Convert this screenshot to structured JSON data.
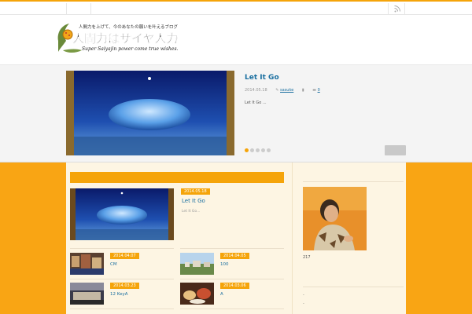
{
  "topbar": {
    "home_label": " ",
    "rss_icon": "rss-icon"
  },
  "header": {
    "logo_tagline": "人間力を上げて、今のあなたの願いを叶えるブログ",
    "logo_title": "人間力はサイヤ人力",
    "logo_subtitle": "Super Saiyajin power come true wishes."
  },
  "slider": {
    "title": "Let It Go",
    "date": "2014.05.18",
    "author": "sasuke",
    "comments": "0",
    "excerpt": "Let It Go ...",
    "slide_count": 5,
    "active_index": 0
  },
  "main": {
    "featured": {
      "date": "2014.05.18",
      "title": "Let It Go",
      "excerpt": "Let It Go..."
    },
    "posts": [
      {
        "date": "2014.04.07",
        "title": "CM"
      },
      {
        "date": "2014.04.05",
        "title": "100"
      },
      {
        "date": "2014.03.23",
        "title": "12 KeyA"
      },
      {
        "date": "2014.03.06",
        "title": "A"
      }
    ]
  },
  "sidebar": {
    "profile_count": "217",
    "items": [
      "-",
      "-"
    ]
  },
  "colors": {
    "accent": "#f5a40a",
    "link": "#1a6fa0",
    "content_bg": "#fdf5e3"
  }
}
